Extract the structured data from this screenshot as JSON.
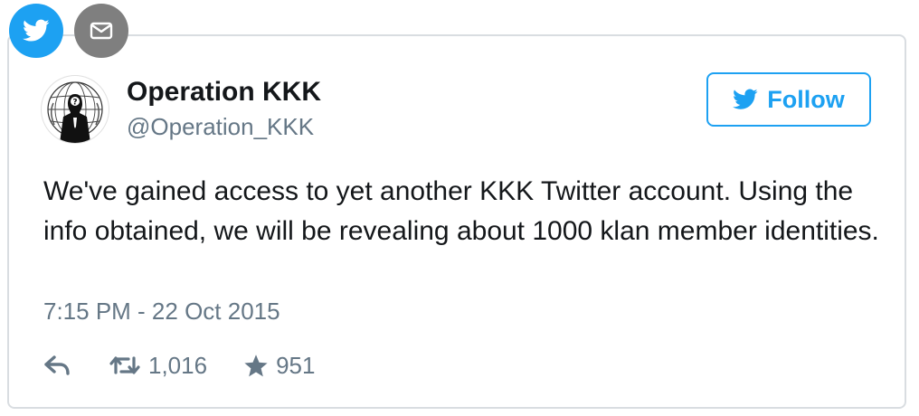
{
  "share": {
    "twitter_icon": "twitter-bird-icon",
    "email_icon": "envelope-icon"
  },
  "user": {
    "display_name": "Operation KKK",
    "handle": "@Operation_KKK",
    "avatar_icon": "anonymous-mask-logo"
  },
  "follow": {
    "label": "Follow"
  },
  "tweet": {
    "text": "We've gained access to yet another KKK Twitter account. Using the info obtained, we will be revealing about 1000 klan member identities.",
    "timestamp": "7:15 PM - 22 Oct 2015"
  },
  "actions": {
    "reply_icon": "reply-icon",
    "retweet_icon": "retweet-icon",
    "retweet_count": "1,016",
    "like_icon": "star-icon",
    "like_count": "951"
  },
  "colors": {
    "twitter_blue": "#1da1f2",
    "email_gray": "#7f7f7f",
    "text_dark": "#14171a",
    "text_gray": "#657786",
    "border": "#d9dde1"
  }
}
